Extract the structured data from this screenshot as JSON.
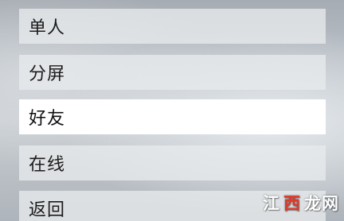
{
  "menu": {
    "items": [
      {
        "label": "单人"
      },
      {
        "label": "分屏"
      },
      {
        "label": "好友",
        "selected": true
      },
      {
        "label": "在线"
      },
      {
        "label": "返回"
      }
    ]
  },
  "watermark": {
    "part1": "江",
    "part2": "西",
    "part3": "龙网"
  },
  "colors": {
    "selected_bg": "#ffffff",
    "item_bg": "#e8eaec",
    "watermark_red": "#e23a2a"
  }
}
